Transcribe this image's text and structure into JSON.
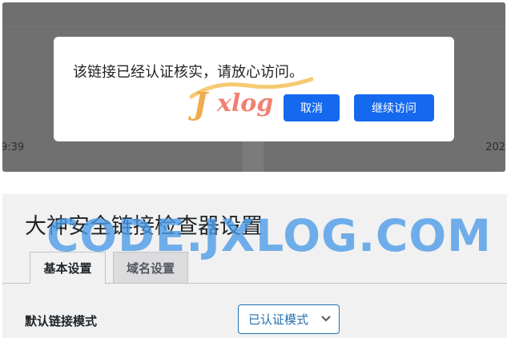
{
  "dialog": {
    "message": "该链接已经认证核实，请放心访问。",
    "cancel_label": "取消",
    "continue_label": "继续访问"
  },
  "background": {
    "time_left": "9:39",
    "time_right": "202"
  },
  "logo": {
    "text": "Jxlog"
  },
  "settings": {
    "title": "大神安全链接检查器设置",
    "tabs": [
      {
        "label": "基本设置",
        "active": true
      },
      {
        "label": "域名设置",
        "active": false
      }
    ],
    "default_mode_label": "默认链接模式",
    "default_mode_value": "已认证模式"
  },
  "watermark": {
    "text": "CODE.JXLOG.COM"
  },
  "colors": {
    "primary_button": "#1469ef",
    "select_accent": "#2271b1",
    "watermark": "#4a9be8",
    "overlay": "#707070"
  },
  "icons": {
    "select_arrow": "chevron-down-icon"
  }
}
